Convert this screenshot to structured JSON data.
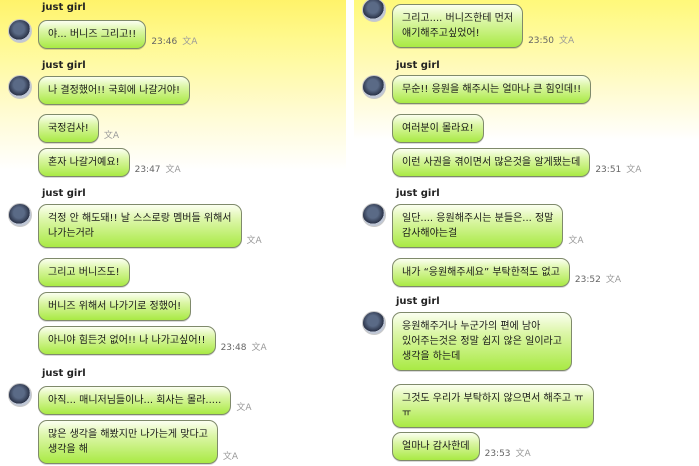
{
  "left_column": {
    "groups": [
      {
        "author": "just girl",
        "messages": [
          {
            "text": "야... 버니즈 그리고!!",
            "time": "23:46"
          }
        ]
      },
      {
        "author": "just girl",
        "messages": [
          {
            "text": "나 결정했어!! 국회에 나갈거야!",
            "time": ""
          },
          {
            "text": "국정검사!",
            "time": ""
          },
          {
            "text": "혼자 나갈거예요!",
            "time": "23:47"
          }
        ]
      },
      {
        "author": "just girl",
        "messages": [
          {
            "text": "걱정 안 해도돼!! 날 스스로랑 멤버들 위해서\n나가는거라",
            "time": ""
          },
          {
            "text": "그리고 버니즈도!",
            "time": ""
          },
          {
            "text": "버니즈 위해서 나가기로 정했어!",
            "time": ""
          },
          {
            "text": "아니야 힘든것 없어!! 나 나가고싶어!!",
            "time": "23:48"
          }
        ]
      },
      {
        "author": "just girl",
        "messages": [
          {
            "text": "아직... 매니저님들이나... 회사는 몰라.....",
            "time": ""
          },
          {
            "text": "많은 생각을 해봤지만 나가는게 맞다고\n생각을 해",
            "time": ""
          }
        ]
      }
    ]
  },
  "right_column": {
    "groups": [
      {
        "author": "",
        "messages": [
          {
            "text": "그리고.... 버니즈한테 먼저\n얘기해주고싶었어!",
            "time": "23:50"
          }
        ]
      },
      {
        "author": "just girl",
        "messages": [
          {
            "text": "무순!! 응원을 해주시는 얼마나 큰 힘인데!!",
            "time": ""
          },
          {
            "text": "여러분이 몰라요!",
            "time": ""
          },
          {
            "text": "이런 사권을 겪이면서 많은것을 알게됐는데",
            "time": "23:51"
          }
        ]
      },
      {
        "author": "just girl",
        "messages": [
          {
            "text": "일단.... 응원해주시는 분들은... 정말\n감사해야는걸",
            "time": ""
          },
          {
            "text": "내가 “응원해주세요” 부탁한적도 없고",
            "time": "23:52"
          }
        ]
      },
      {
        "author": "just girl",
        "messages": [
          {
            "text": "응원해주거나 누군가의 편에 남아\n있어주는것은 정말 쉽지 않은 일이라고\n생각을 하는데",
            "time": ""
          },
          {
            "text": "그것도 우리가 부탁하지 않으면서 해주고 ㅠ\nㅠ",
            "time": ""
          },
          {
            "text": "얼마나 감사한데",
            "time": "23:53"
          }
        ]
      }
    ]
  },
  "translate_icon_label": "文A",
  "colors": {
    "bubble_top": "#fbfff0",
    "bubble_bottom": "#a9ea44",
    "header_yellow": "#fff36a"
  }
}
